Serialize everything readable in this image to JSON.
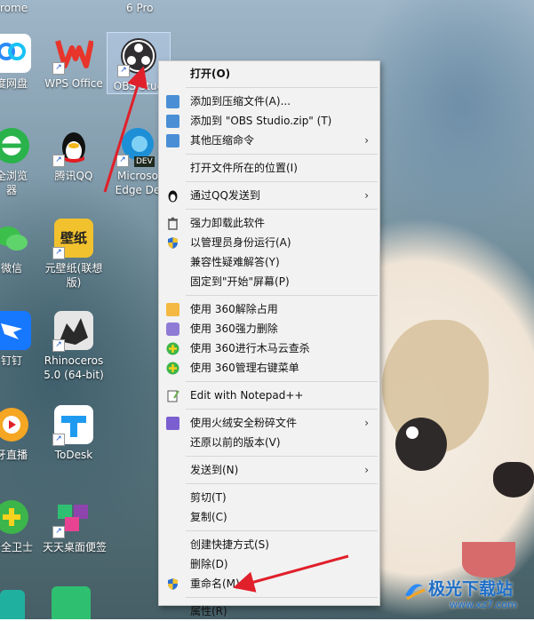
{
  "desktop": {
    "top_labels": [
      "rome",
      "6 Pro"
    ],
    "icons": [
      {
        "label": "度网盘",
        "name": "baidu-netdisk"
      },
      {
        "label": "WPS Office",
        "name": "wps-office"
      },
      {
        "label": "OBS Stud",
        "name": "obs-studio"
      },
      {
        "label": "全浏览\n器",
        "name": "360-browser"
      },
      {
        "label": "腾讯QQ",
        "name": "tencent-qq"
      },
      {
        "label": "Microso\nEdge De",
        "name": "edge-dev"
      },
      {
        "label": "微信",
        "name": "wechat"
      },
      {
        "label": "元壁纸(联想\n版)",
        "name": "wallpaper-app"
      },
      {
        "label": "钉钉",
        "name": "dingtalk"
      },
      {
        "label": "Rhinoceros\n5.0 (64-bit)",
        "name": "rhinoceros"
      },
      {
        "label": "牙直播",
        "name": "huya-live"
      },
      {
        "label": "ToDesk",
        "name": "todesk"
      },
      {
        "label": "安全卫士",
        "name": "360-safe"
      },
      {
        "label": "天天桌面便签",
        "name": "desktop-notes"
      }
    ],
    "edge_badge": "DEV",
    "wallpaper_app_badge": "壁纸"
  },
  "menu": {
    "open": "打开(O)",
    "add_archive": "添加到压缩文件(A)...",
    "add_zip": "添加到 \"OBS Studio.zip\" (T)",
    "other_compress": "其他压缩命令",
    "open_location": "打开文件所在的位置(I)",
    "send_qq": "通过QQ发送到",
    "force_uninstall": "强力卸载此软件",
    "run_admin": "以管理员身份运行(A)",
    "troubleshoot": "兼容性疑难解答(Y)",
    "pin_start": "固定到\"开始\"屏幕(P)",
    "unlock_360": "使用 360解除占用",
    "delete_360": "使用 360强力删除",
    "trojan_360": "使用 360进行木马云查杀",
    "rightmenu_360": "使用 360管理右键菜单",
    "notepad": "Edit with Notepad++",
    "huorong": "使用火绒安全粉碎文件",
    "restore": "还原以前的版本(V)",
    "send_to": "发送到(N)",
    "cut": "剪切(T)",
    "copy": "复制(C)",
    "shortcut": "创建快捷方式(S)",
    "delete": "删除(D)",
    "rename": "重命名(M)",
    "properties": "属性(R)"
  },
  "watermark": {
    "text": "极光下载站",
    "url": "www.xz7.com"
  },
  "colors": {
    "accent_red": "#e0202a",
    "menu_bg": "#f2f2f2"
  }
}
